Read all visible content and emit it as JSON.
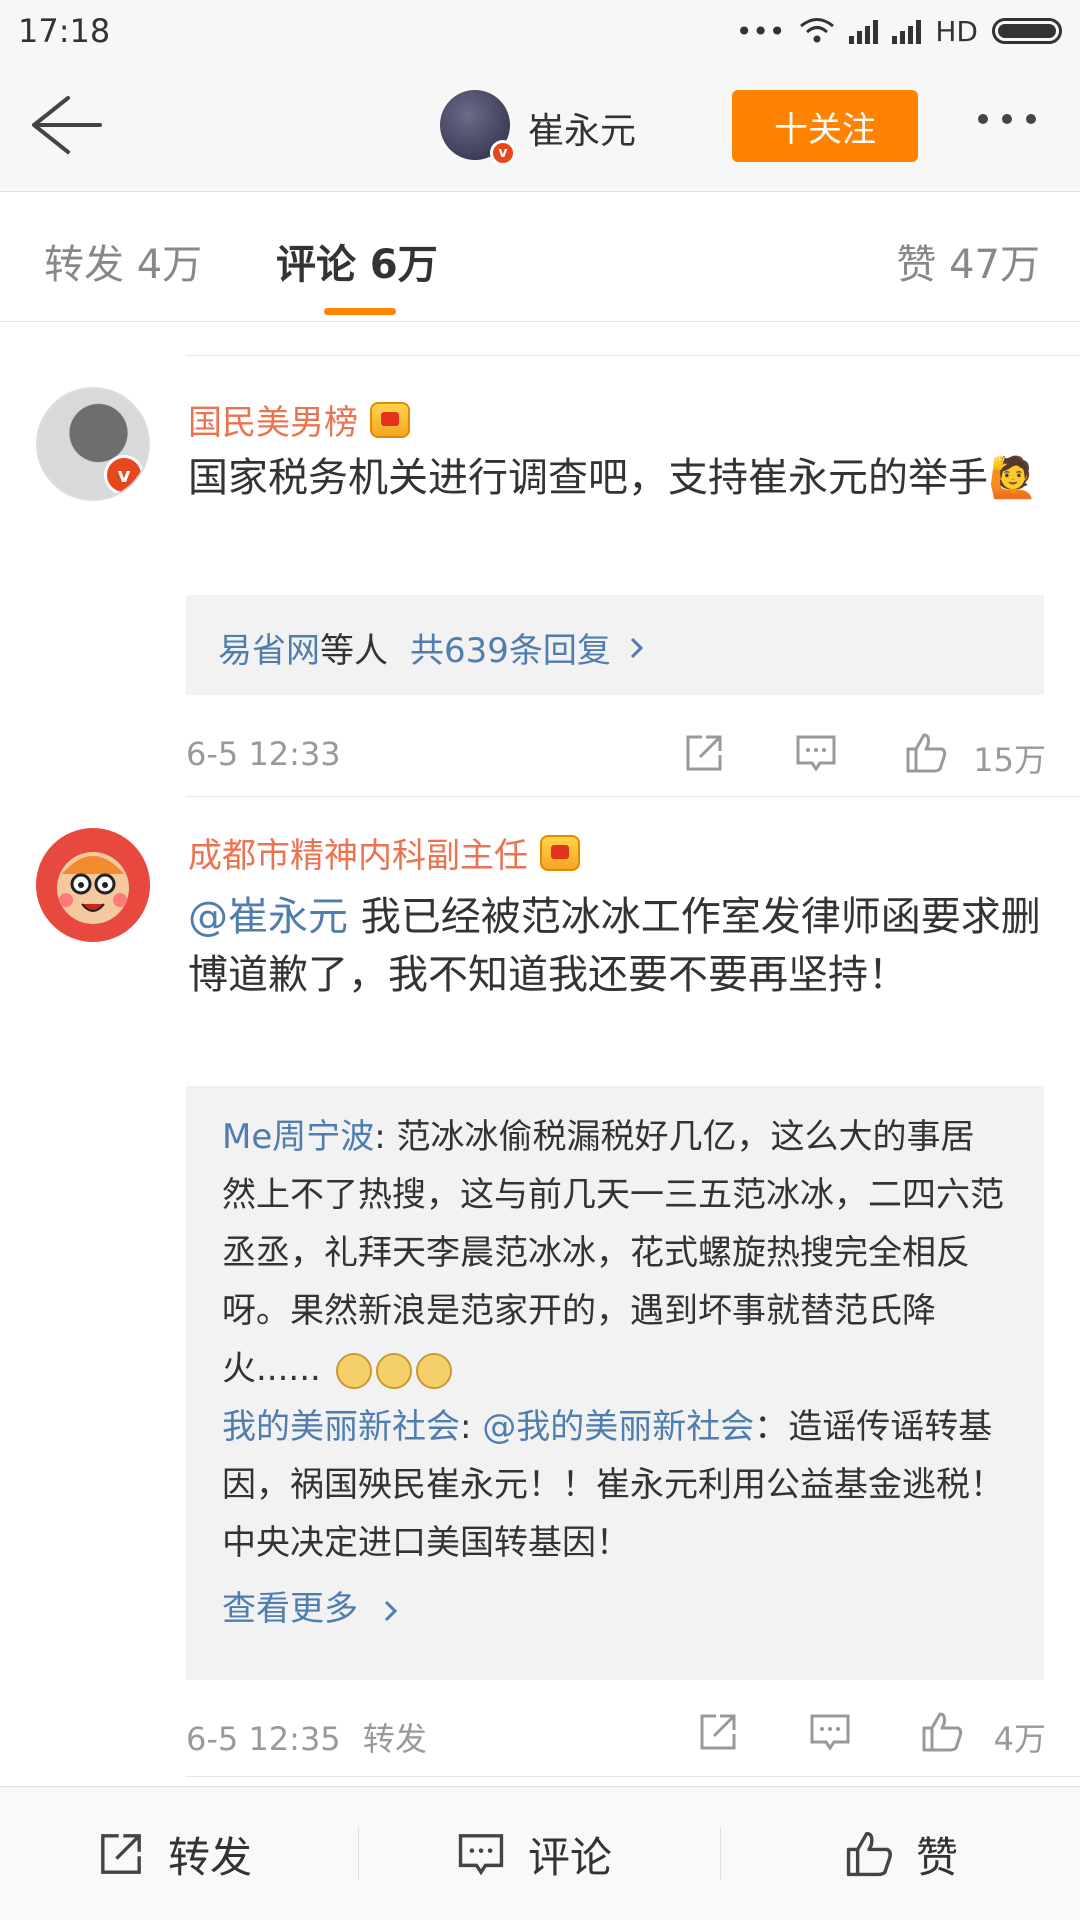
{
  "status_bar": {
    "time": "17:18",
    "network": "HD"
  },
  "header": {
    "username": "崔永元",
    "follow_label": "十关注"
  },
  "tabs": {
    "forward": "转发 4万",
    "comment": "评论 6万",
    "like": "赞 47万"
  },
  "comments": [
    {
      "author": "国民美男榜",
      "text": "国家税务机关进行调查吧，支持崔永元的举手",
      "reply_summary": {
        "user": "易省网",
        "middle": "等人",
        "count_label": "共639条回复"
      },
      "time": "6-5 12:33",
      "like_count": "15万"
    },
    {
      "author": "成都市精神内科副主任",
      "mention": "@崔永元",
      "text": " 我已经被范冰冰工作室发律师函要求删博道歉了，我不知道我还要不要再坚持！",
      "replies": [
        {
          "user": "Me周宁波",
          "text": ": 范冰冰偷税漏税好几亿，这么大的事居然上不了热搜，这与前几天一三五范冰冰，二四六范丞丞，礼拜天李晨范冰冰，花式螺旋热搜完全相反呀。果然新浪是范家开的，遇到坏事就替范氏降火......"
        },
        {
          "user": "我的美丽新社会",
          "mention": "@我的美丽新社会",
          "text": "：造谣传谣转基因，祸国殃民崔永元！！崔永元利用公益基金逃税！中央决定进口美国转基因！"
        }
      ],
      "view_more": "查看更多",
      "time": "6-5 12:35",
      "forward_label": "转发",
      "like_count": "4万"
    }
  ],
  "bottom_bar": {
    "forward": "转发",
    "comment": "评论",
    "like": "赞"
  },
  "colors": {
    "accent": "#ff8200",
    "link": "#507daf",
    "author": "#eb7350"
  }
}
